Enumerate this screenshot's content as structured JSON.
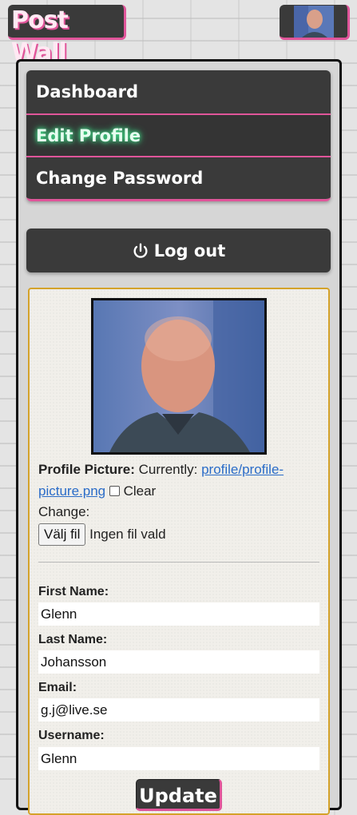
{
  "header": {
    "logo_text": "Post Wall",
    "avatar_icon": "profile-avatar"
  },
  "nav": {
    "items": [
      {
        "label": "Dashboard",
        "active": false
      },
      {
        "label": "Edit Profile",
        "active": true
      },
      {
        "label": "Change Password",
        "active": false
      }
    ]
  },
  "logout": {
    "icon": "power-icon",
    "label": "Log out"
  },
  "profile": {
    "picture_label": "Profile Picture:",
    "currently_label": "Currently:",
    "current_file_link_line1": "profile/profile-",
    "current_file_link_line2": "picture.png",
    "clear_label": "Clear",
    "change_label": "Change:",
    "file_button_label": "Välj fil",
    "file_status": "Ingen fil vald"
  },
  "form": {
    "first_name": {
      "label": "First Name:",
      "value": "Glenn"
    },
    "last_name": {
      "label": "Last Name:",
      "value": "Johansson"
    },
    "email": {
      "label": "Email:",
      "value": "g.j@live.se"
    },
    "username": {
      "label": "Username:",
      "value": "Glenn"
    },
    "submit_label": "Update"
  },
  "colors": {
    "accent": "#e0559a",
    "card_border": "#d4a22a",
    "dark": "#3a3a3a",
    "active_glow": "#3fe08a"
  }
}
